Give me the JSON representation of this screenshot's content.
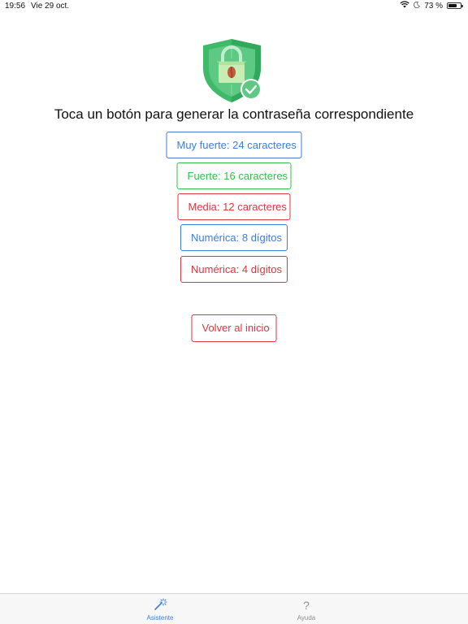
{
  "status_bar": {
    "time": "19:56",
    "date": "Vie 29 oct.",
    "battery_text": "73 %",
    "battery_level": 0.73
  },
  "main": {
    "headline": "Toca un botón para generar la contraseña correspondiente",
    "buttons": [
      {
        "label": "Muy fuerte: 24 caracteres",
        "color": "#3b7ddd"
      },
      {
        "label": "Fuerte: 16 caracteres",
        "color": "#2fbf4a"
      },
      {
        "label": "Media: 12 caracteres",
        "color": "#e5333d"
      },
      {
        "label": "Numérica: 8 dígitos",
        "color": "#3b7ddd"
      },
      {
        "label": "Numérica: 4 dígitos",
        "color": "#e5333d"
      }
    ],
    "back_button": {
      "label": "Volver al inicio",
      "color": "#e5333d"
    }
  },
  "tab_bar": {
    "tabs": [
      {
        "label": "Asistente",
        "icon": "magic-wand-icon",
        "active": true
      },
      {
        "label": "Ayuda",
        "icon": "question-icon",
        "active": false
      }
    ]
  },
  "colors": {
    "accent_blue": "#3b7ddd",
    "accent_green": "#2fbf4a",
    "accent_red": "#e5333d",
    "shield_green": "#3fb96a"
  }
}
